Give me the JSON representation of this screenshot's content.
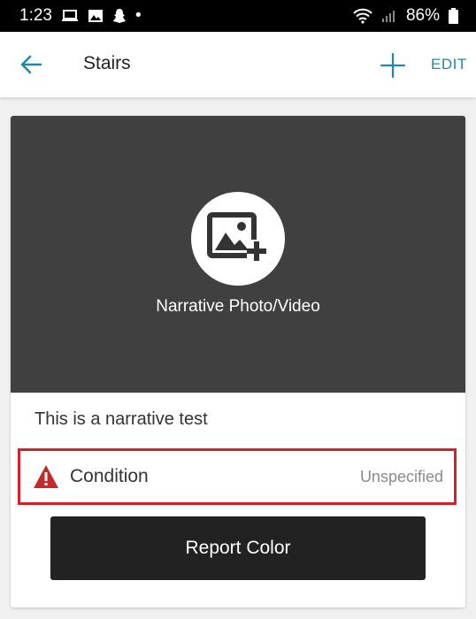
{
  "status_bar": {
    "time": "1:23",
    "battery": "86%",
    "dot": "•"
  },
  "app_bar": {
    "title": "Stairs",
    "edit_label": "EDIT",
    "accent_color": "#1e88a8"
  },
  "card": {
    "media_label": "Narrative Photo/Video",
    "narrative": "This is a narrative test",
    "condition": {
      "label": "Condition",
      "value": "Unspecified",
      "icon": "warning-icon",
      "highlight_color": "#d61f26"
    },
    "report_button_label": "Report Color"
  }
}
